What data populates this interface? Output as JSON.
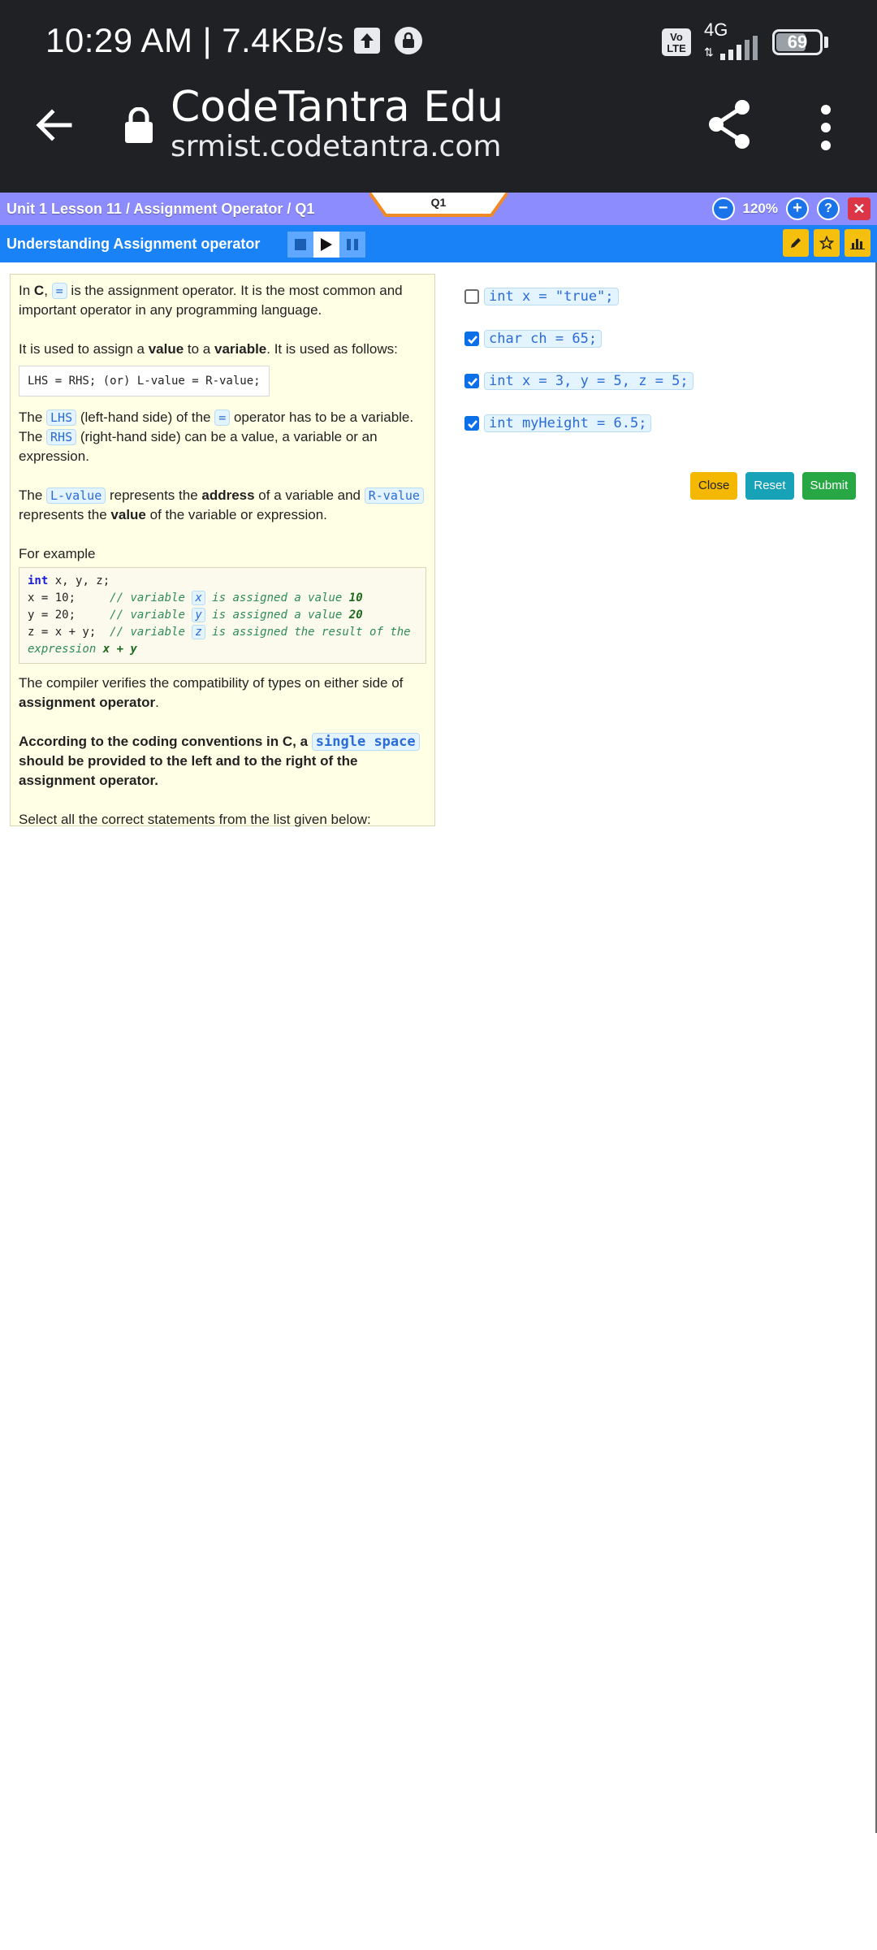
{
  "status_bar": {
    "time_speed": "10:29 AM | 7.4KB/s",
    "volte": "Vo LTE",
    "network": "4G",
    "battery": "69",
    "battery_level": 0.69
  },
  "browser": {
    "site_title": "CodeTantra Edu",
    "url": "srmist.codetantra.com"
  },
  "app_bar": {
    "breadcrumb": "Unit 1 Lesson 11 / Assignment Operator / Q1",
    "question_tab": "Q1",
    "zoom": "120%",
    "zoom_out": "−",
    "zoom_in": "+",
    "help": "?",
    "close": "✕"
  },
  "title_bar": {
    "title": "Understanding Assignment operator"
  },
  "question": {
    "p1_a": "In ",
    "p1_c": "C",
    "p1_b": ",",
    "op": "=",
    "p1_c2": " is the assignment operator. It is the most common and important operator in any programming language.",
    "p2_a": "It is used to assign a ",
    "p2_value": "value",
    "p2_b": " to a ",
    "p2_variable": "variable",
    "p2_c": ". It is used as follows:",
    "syntax": "LHS = RHS; (or) L-value = R-value;",
    "p3_a": "The ",
    "lhs": "LHS",
    "p3_b": " (left-hand side) of the ",
    "p3_c": " operator has to be a variable. The ",
    "rhs": "RHS",
    "p3_d": " (right-hand side) can be a value, a variable or an expression.",
    "p4_a": "The ",
    "lvalue": "L-value",
    "p4_b": " represents the ",
    "address": "address",
    "p4_c": " of a variable and ",
    "rvalue": "R-value",
    "p4_d": " represents the ",
    "value": "value",
    "p4_e": " of the variable or expression.",
    "example_label": "For example",
    "code": {
      "l1_kw": "int",
      "l1_rest": " x, y, z;",
      "l2_code": "x = 10;     ",
      "l2_cm": "// variable ",
      "l2_var": "x",
      "l2_cm2": " is assigned a value ",
      "l2_val": "10",
      "l3_code": "y = 20;     ",
      "l3_cm": "// variable ",
      "l3_var": "y",
      "l3_cm2": " is assigned a value ",
      "l3_val": "20",
      "l4_code": "z = x + y;  ",
      "l4_cm": "// variable ",
      "l4_var": "z",
      "l4_cm2": " is assigned the result of the expression ",
      "l4_val": "x + y"
    },
    "p5_a": "The compiler verifies the compatibility of types on either side of ",
    "p5_b": "assignment operator",
    "p5_c": ".",
    "p6_a": "According to the coding conventions in C, a ",
    "single_space": "single space",
    "p6_b": " should be provided to the left and to the right of the assignment operator.",
    "p7": "Select all the correct statements from the list given below:"
  },
  "options": [
    {
      "code": "int x = \"true\";",
      "checked": false
    },
    {
      "code": "char ch = 65;",
      "checked": true
    },
    {
      "code": "int x = 3, y = 5, z = 5;",
      "checked": true
    },
    {
      "code": "int myHeight = 6.5;",
      "checked": true
    }
  ],
  "actions": {
    "close": "Close",
    "reset": "Reset",
    "submit": "Submit"
  },
  "colors": {
    "app_bar": "#8c8cff",
    "title_bar": "#1a82f7",
    "panel_bg": "#ffffe6",
    "close_btn": "#f4b800",
    "reset_btn": "#17a2b8",
    "submit_btn": "#28a745"
  }
}
